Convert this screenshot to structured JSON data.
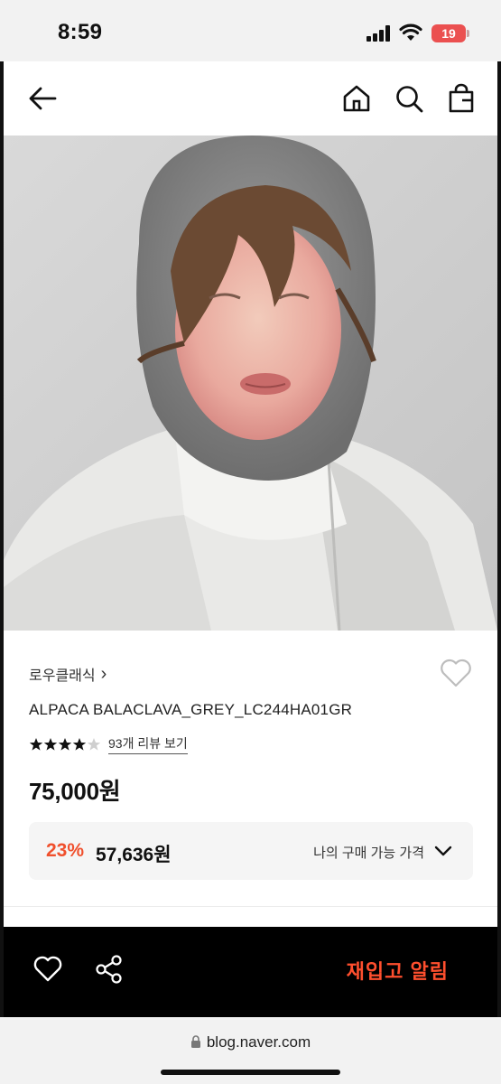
{
  "status": {
    "time": "8:59",
    "battery": "19"
  },
  "nav": {
    "back": "back-arrow-icon",
    "home": "home-icon",
    "search": "search-icon",
    "bag": "shopping-bag-icon"
  },
  "product": {
    "brand": "로우클래식",
    "brand_chevron": "›",
    "name": "ALPACA BALACLAVA_GREY_LC244HA01GR",
    "rating_stars": 4.5,
    "review_link": "93개 리뷰 보기",
    "price": "75,000원",
    "benefit": {
      "discount": "23%",
      "price": "57,636원",
      "label": "나의 구매 가능 가격"
    }
  },
  "bottom": {
    "restock_label": "재입고 알림"
  },
  "browser": {
    "url": "blog.naver.com"
  },
  "colors": {
    "accent": "#f0502d",
    "restock": "#ff4f2e",
    "battery": "#eb5050"
  }
}
